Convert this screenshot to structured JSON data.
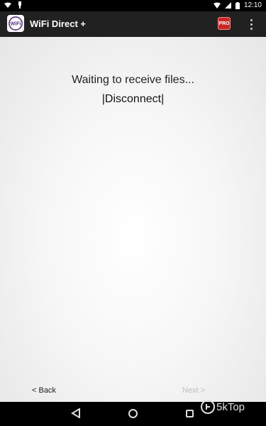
{
  "status_bar": {
    "time": "12:10"
  },
  "app_bar": {
    "title": "WiFi Direct +",
    "logo_text": "WiFi",
    "pro_badge": "PRO"
  },
  "main": {
    "status_text": "Waiting to receive files...",
    "disconnect_label": "|Disconnect|",
    "back_label": "< Back",
    "next_label": "Next >"
  },
  "watermark": {
    "text": "5kTop"
  },
  "colors": {
    "app_bar": "#212121",
    "pro_badge": "#c62828",
    "disabled_text": "#bdbdbd"
  }
}
